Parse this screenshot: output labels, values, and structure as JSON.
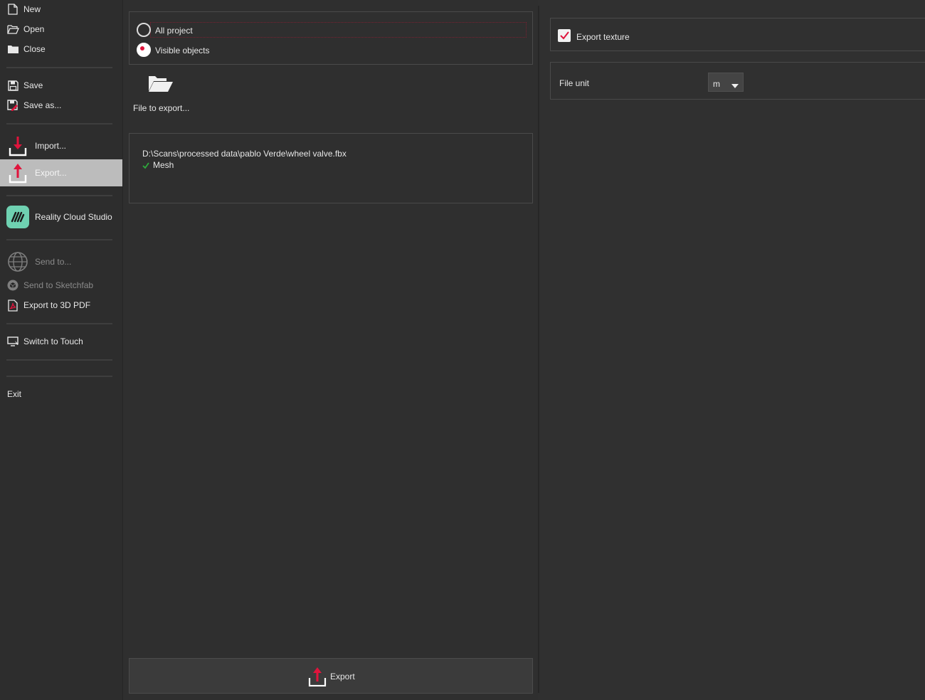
{
  "sidebar": {
    "new": "New",
    "open": "Open",
    "close": "Close",
    "save": "Save",
    "save_as": "Save as...",
    "import": "Import...",
    "export": "Export...",
    "reality_cloud": "Reality Cloud Studio",
    "send_to": "Send to...",
    "send_sketchfab": "Send to Sketchfab",
    "export_pdf": "Export to 3D PDF",
    "switch_touch": "Switch to Touch",
    "exit": "Exit"
  },
  "scope": {
    "all_project": "All project",
    "visible_objects": "Visible objects",
    "selected": "Visible objects"
  },
  "file_to_export": "File to export...",
  "export_list": {
    "path": "D:\\Scans\\processed data\\pablo Verde\\wheel valve.fbx",
    "item": "Mesh"
  },
  "export_button": "Export",
  "options": {
    "export_texture": "Export texture",
    "export_texture_checked": true,
    "file_unit_label": "File unit",
    "file_unit_value": "m"
  },
  "colors": {
    "accent": "#e0143c",
    "check_green": "#2eaa3c",
    "rcs_brand": "#6fd1b1"
  }
}
